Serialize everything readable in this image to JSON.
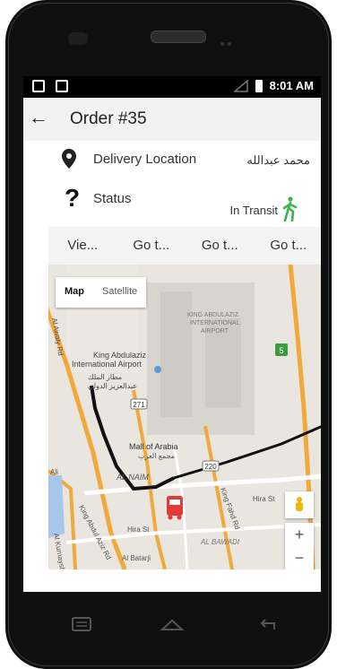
{
  "status_bar": {
    "time": "8:01 AM"
  },
  "app_bar": {
    "title": "Order #35"
  },
  "rows": {
    "delivery": {
      "label": "Delivery Location",
      "value": "محمد عبدالله"
    },
    "status": {
      "label": "Status",
      "value": "In Transit"
    }
  },
  "tabs": [
    "Vie...",
    "Go t...",
    "Go t...",
    "Go t..."
  ],
  "map": {
    "types": [
      "Map",
      "Satellite"
    ],
    "labels": {
      "airport": "King Abdulaziz International Airport",
      "airport_ar1": "مطار الملك",
      "airport_ar2": "عبدالعزيز الدولي",
      "airport_top": "KING ABDULAZIZ",
      "airport_top2": "INTERNATIONAL",
      "airport_top3": "AIRPORT",
      "mall": "Mall of Arabia",
      "mall_ar": "مجمع العرب",
      "alnaim": "AL NAIM",
      "road_271": "271",
      "road_5": "5",
      "road_220": "220",
      "kaaziz": "King Abdul Aziz Rd",
      "kfahd": "King Fahd Rd",
      "hira": "Hira St",
      "hira2": "Hira St",
      "albawadi": "AL BAWADI",
      "albatarji": "Al Batarji",
      "alkurnaysh": "Al Kurnaysh Rd",
      "alawaly": "Al Awaly Rd",
      "ali": "Ali"
    },
    "zoom_in": "+",
    "zoom_out": "−"
  }
}
